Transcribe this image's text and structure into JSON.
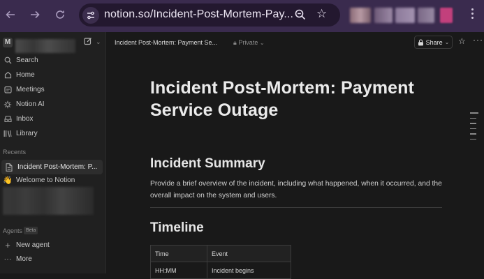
{
  "browser": {
    "url": "notion.so/Incident-Post-Mortem-Pay...",
    "back_icon": "arrow-left-icon",
    "forward_icon": "arrow-right-icon",
    "reload_icon": "reload-icon"
  },
  "sidebar": {
    "workspace_initial": "M",
    "items": [
      {
        "label": "Search",
        "icon": "search-icon"
      },
      {
        "label": "Home",
        "icon": "home-icon"
      },
      {
        "label": "Meetings",
        "icon": "meetings-icon"
      },
      {
        "label": "Notion AI",
        "icon": "notion-ai-icon"
      },
      {
        "label": "Inbox",
        "icon": "inbox-icon"
      },
      {
        "label": "Library",
        "icon": "library-icon"
      }
    ],
    "recents_label": "Recents",
    "recents": [
      {
        "label": "Incident Post-Mortem: P...",
        "icon": "page-icon",
        "active": true
      },
      {
        "label": "Welcome to Notion",
        "icon": "wave-icon",
        "active": false
      }
    ],
    "agents_label": "Agents",
    "agents_badge": "Beta",
    "agent_items": [
      {
        "label": "New agent",
        "icon": "plus-icon"
      },
      {
        "label": "More",
        "icon": "more-icon"
      }
    ]
  },
  "topbar": {
    "breadcrumb": "Incident Post-Mortem: Payment Se...",
    "privacy": "Private",
    "share_label": "Share"
  },
  "page": {
    "title": "Incident Post-Mortem: Payment Service Outage",
    "summary_heading": "Incident Summary",
    "summary_text": "Provide a brief overview of the incident, including what happened, when it occurred, and the overall impact on the system and users.",
    "timeline_heading": "Timeline",
    "timeline_table": {
      "headers": [
        "Time",
        "Event"
      ],
      "rows": [
        [
          "HH:MM",
          "Incident begins"
        ]
      ]
    }
  }
}
